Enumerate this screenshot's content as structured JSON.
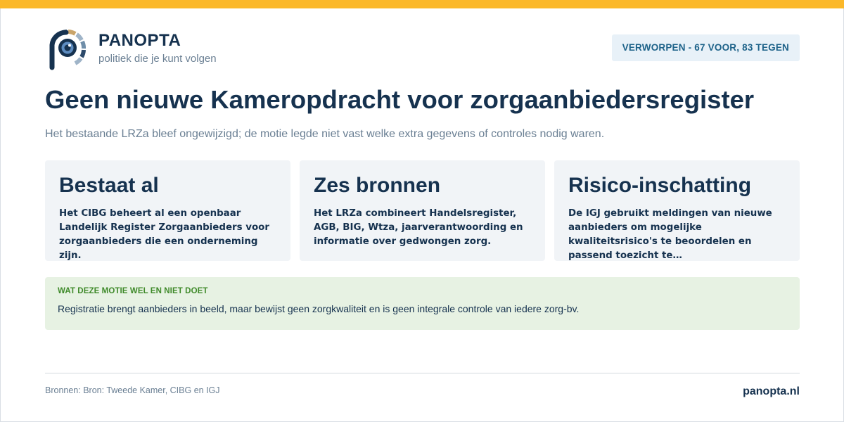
{
  "colors": {
    "accent_bar": "#fbb829",
    "brand": "#16324f",
    "badge_bg": "#e8f1f8",
    "badge_text": "#1d6289",
    "card_bg": "#f1f4f7",
    "note_bg": "#e7f2e3",
    "note_label": "#3f8a2a"
  },
  "header": {
    "logo_icon": "panopta-eye-logo-icon",
    "brand_name": "PANOPTA",
    "tagline": "politiek die je kunt volgen",
    "status_badge": "VERWORPEN - 67 VOOR, 83 TEGEN"
  },
  "main": {
    "title": "Geen nieuwe Kameropdracht voor zorgaanbiedersregister",
    "subtitle": "Het bestaande LRZa bleef ongewijzigd; de motie legde niet vast welke extra gegevens of controles nodig waren."
  },
  "cards": [
    {
      "title": "Bestaat al",
      "body": "Het CIBG beheert al een openbaar Landelijk Register Zorgaanbieders voor zorgaanbieders die een onderneming zijn."
    },
    {
      "title": "Zes bronnen",
      "body": "Het LRZa combineert Handelsregister, AGB, BIG, Wtza, jaarverantwoording en informatie over gedwongen zorg."
    },
    {
      "title": "Risico-inschatting",
      "body": "De IGJ gebruikt meldingen van nieuwe aanbieders om mogelijke kwaliteitsrisico's te beoordelen en passend toezicht te…"
    }
  ],
  "note": {
    "label": "WAT DEZE MOTIE WEL EN NIET DOET",
    "text": "Registratie brengt aanbieders in beeld, maar bewijst geen zorgkwaliteit en is geen integrale controle van iedere zorg-bv."
  },
  "footer": {
    "sources": "Bronnen: Bron: Tweede Kamer, CIBG en IGJ",
    "site": "panopta.nl"
  }
}
